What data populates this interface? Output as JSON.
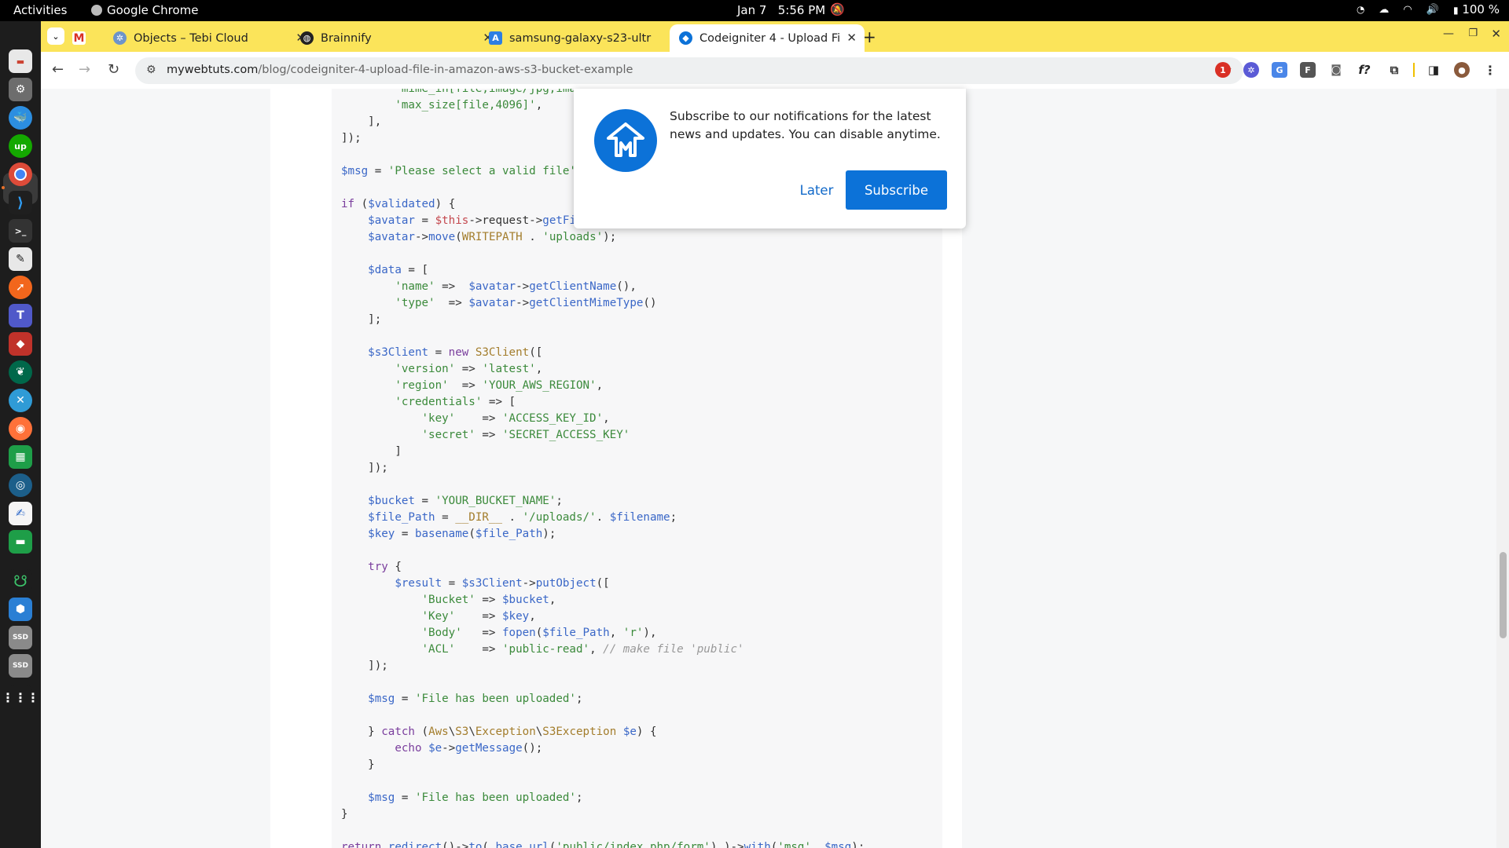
{
  "topbar": {
    "activities": "Activities",
    "app_name": "Google Chrome",
    "date": "Jan 7",
    "time": "5:56 PM",
    "battery": "100 %"
  },
  "tabs": [
    {
      "title": "",
      "favicon": "gmail-icon"
    },
    {
      "title": "Objects – Tebi Cloud",
      "favicon": "tebi-icon"
    },
    {
      "title": "Brainnify",
      "favicon": "github-icon"
    },
    {
      "title": "samsung-galaxy-s23-ultr",
      "favicon": "translate-icon"
    },
    {
      "title": "Codeigniter 4 - Upload Fi",
      "favicon": "mywebtuts-icon",
      "active": true
    }
  ],
  "address_bar": {
    "host": "mywebtuts.com",
    "path": "/blog/codeigniter-4-upload-file-in-amazon-aws-s3-bucket-example"
  },
  "notification_popup": {
    "message": "Subscribe to our notifications for the latest news and updates. You can disable anytime.",
    "later_label": "Later",
    "subscribe_label": "Subscribe",
    "brand_color": "#0c72d8"
  },
  "code_lines": [
    "        'mime_in[file,image/jpg,image/jpeg,image/gif,image/png,image/webp]',",
    "        'max_size[file,4096]',",
    "    ],",
    "]);",
    "",
    "$msg = 'Please select a valid file';",
    "",
    "if ($validated) {",
    "    $avatar = $this->request->getFile('file');",
    "    $avatar->move(WRITEPATH . 'uploads');",
    "",
    "    $data = [",
    "        'name' =>  $avatar->getClientName(),",
    "        'type'  => $avatar->getClientMimeType()",
    "    ];",
    "",
    "    $s3Client = new S3Client([",
    "        'version' => 'latest',",
    "        'region'  => 'YOUR_AWS_REGION',",
    "        'credentials' => [",
    "            'key'    => 'ACCESS_KEY_ID',",
    "            'secret' => 'SECRET_ACCESS_KEY'",
    "        ]",
    "    ]);",
    "",
    "    $bucket = 'YOUR_BUCKET_NAME';",
    "    $file_Path = __DIR__ . '/uploads/'. $filename;",
    "    $key = basename($file_Path);",
    "",
    "    try {",
    "        $result = $s3Client->putObject([",
    "            'Bucket' => $bucket,",
    "            'Key'    => $key,",
    "            'Body'   => fopen($file_Path, 'r'),",
    "            'ACL'    => 'public-read', // make file 'public'",
    "    ]);",
    "",
    "    $msg = 'File has been uploaded';",
    "",
    "    } catch (Aws\\S3\\Exception\\S3Exception $e) {",
    "        echo $e->getMessage();",
    "    }",
    "",
    "    $msg = 'File has been uploaded';",
    "}",
    "",
    "return redirect()->to( base_url('public/index.php/form') )->with('msg', $msg);"
  ]
}
